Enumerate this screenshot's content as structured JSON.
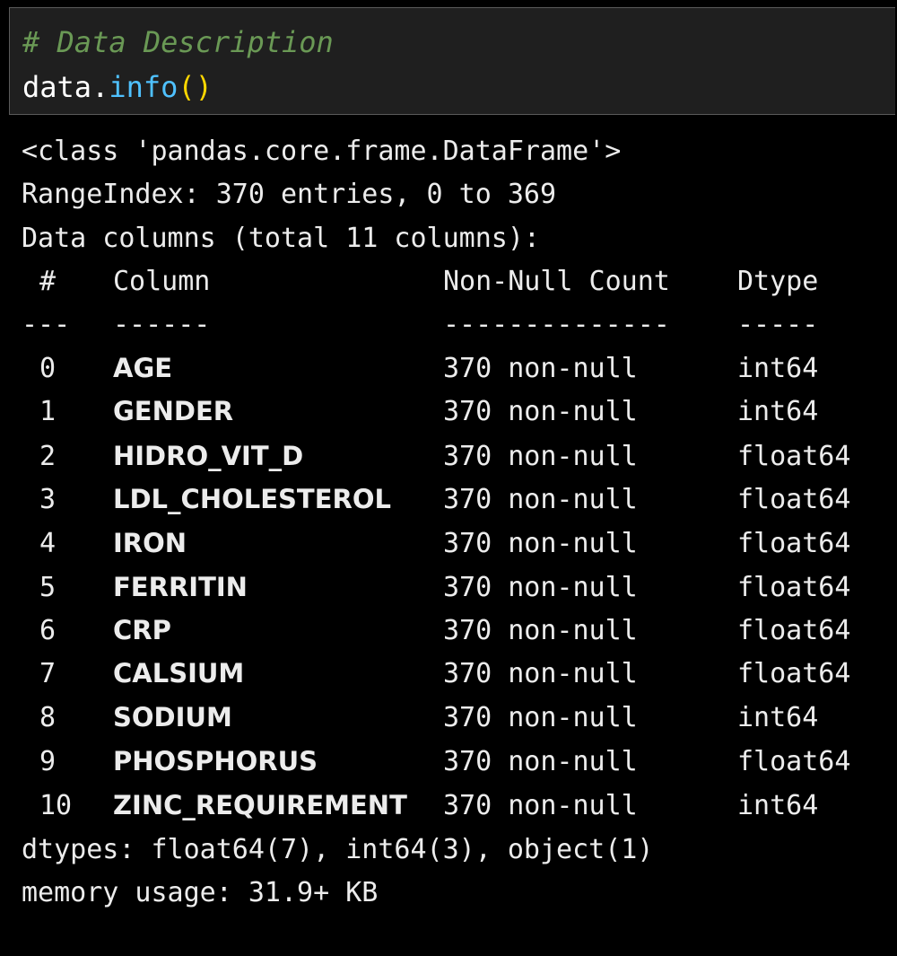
{
  "input_cell": {
    "comment": "# Data Description",
    "code_var": "data",
    "code_dot": ".",
    "code_method": "info",
    "code_parens": "()"
  },
  "output": {
    "class_line": "<class 'pandas.core.frame.DataFrame'>",
    "range_index": "RangeIndex: 370 entries, 0 to 369",
    "data_columns": "Data columns (total 11 columns):",
    "headers": {
      "index": "#",
      "column": "Column",
      "non_null": "Non-Null Count",
      "dtype": "Dtype"
    },
    "separators": {
      "index": "---",
      "column": "------",
      "non_null": "--------------",
      "dtype": "-----"
    },
    "rows": [
      {
        "index": "0",
        "column": "AGE",
        "non_null": "370 non-null",
        "dtype": "int64"
      },
      {
        "index": "1",
        "column": "GENDER",
        "non_null": "370 non-null",
        "dtype": "int64"
      },
      {
        "index": "2",
        "column": "HIDRO_VIT_D",
        "non_null": "370 non-null",
        "dtype": "float64"
      },
      {
        "index": "3",
        "column": "LDL_CHOLESTEROL",
        "non_null": "370 non-null",
        "dtype": "float64"
      },
      {
        "index": "4",
        "column": "IRON",
        "non_null": "370 non-null",
        "dtype": "float64"
      },
      {
        "index": "5",
        "column": "FERRITIN",
        "non_null": "370 non-null",
        "dtype": "float64"
      },
      {
        "index": "6",
        "column": "CRP",
        "non_null": "370 non-null",
        "dtype": "float64"
      },
      {
        "index": "7",
        "column": "CALSIUM",
        "non_null": "370 non-null",
        "dtype": "float64"
      },
      {
        "index": "8",
        "column": "SODIUM",
        "non_null": "370 non-null",
        "dtype": "int64"
      },
      {
        "index": "9",
        "column": "PHOSPHORUS",
        "non_null": "370 non-null",
        "dtype": "float64"
      },
      {
        "index": "10",
        "column": "ZINC_REQUIREMENT",
        "non_null": "370 non-null",
        "dtype": "int64"
      }
    ],
    "dtypes_summary": "dtypes: float64(7), int64(3), object(1)",
    "memory_usage": "memory usage: 31.9+ KB"
  }
}
